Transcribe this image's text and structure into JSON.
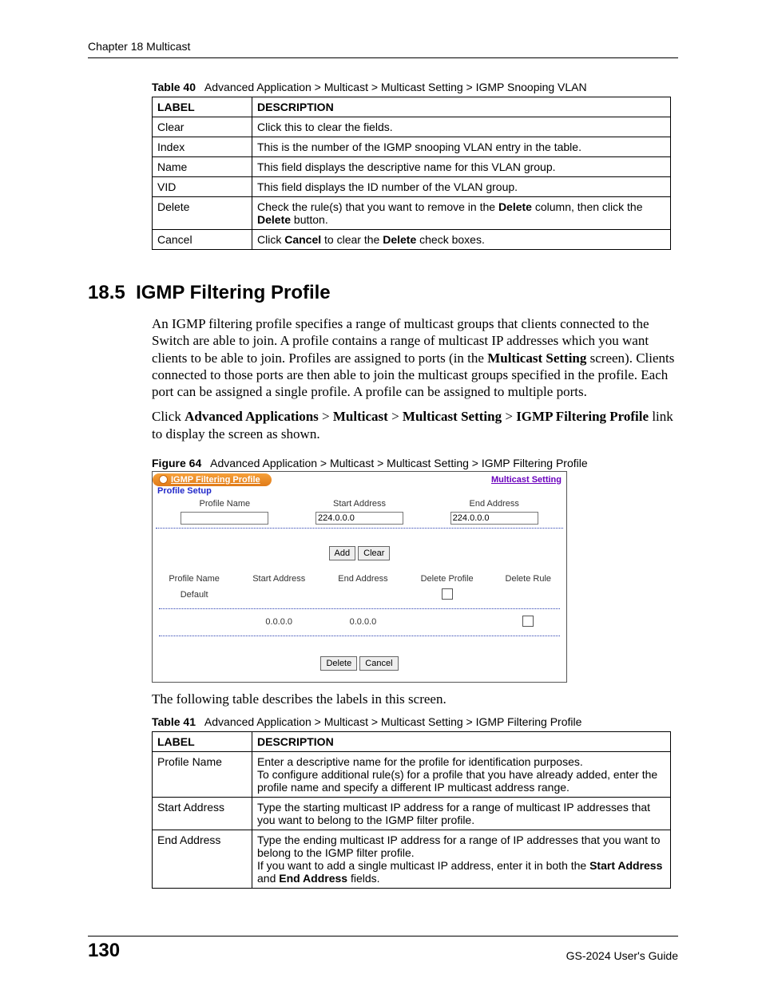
{
  "runningHead": "Chapter 18 Multicast",
  "table40": {
    "captionPrefix": "Table 40",
    "caption": "Advanced Application > Multicast > Multicast Setting > IGMP Snooping VLAN",
    "headerLabel": "LABEL",
    "headerDesc": "DESCRIPTION",
    "rows": [
      {
        "label": "Clear",
        "desc": "Click this to clear the fields."
      },
      {
        "label": "Index",
        "desc": "This is the number of the IGMP snooping VLAN entry in the table."
      },
      {
        "label": "Name",
        "desc": "This field displays the descriptive name for this VLAN group."
      },
      {
        "label": "VID",
        "desc": "This field displays the ID number of the VLAN group."
      },
      {
        "label": "Delete",
        "desc_html": "Check the rule(s) that you want to remove in the <b>Delete</b> column, then click the <b>Delete</b> button."
      },
      {
        "label": "Cancel",
        "desc_html": "Click <b>Cancel</b> to clear the <b>Delete</b> check boxes."
      }
    ]
  },
  "sectionNumber": "18.5",
  "sectionTitle": "IGMP Filtering Profile",
  "para1_html": "An IGMP filtering profile specifies a range of multicast groups that clients connected to the Switch are able to join. A profile contains a range of multicast IP addresses which you want clients to be able to join. Profiles are assigned to ports (in the <b>Multicast Setting</b> screen). Clients connected to those ports are then able to join the multicast groups specified in the profile. Each port can be assigned a single profile. A profile can be assigned to multiple ports.",
  "para2_html": "Click <b>Advanced Applications</b> > <b>Multicast</b> > <b>Multicast Setting</b> > <b>IGMP Filtering Profile</b> link to display the screen as shown.",
  "figure64": {
    "captionPrefix": "Figure 64",
    "caption": "Advanced Application > Multicast > Multicast Setting > IGMP Filtering Profile"
  },
  "screenshot": {
    "title": "IGMP Filtering Profile",
    "rightLink": "Multicast Setting",
    "subhead": "Profile Setup",
    "col1": "Profile Name",
    "col2": "Start Address",
    "col3": "End Address",
    "startDefault": "224.0.0.0",
    "endDefault": "224.0.0.0",
    "btnAdd": "Add",
    "btnClear": "Clear",
    "tbl": {
      "h1": "Profile Name",
      "h2": "Start Address",
      "h3": "End Address",
      "h4": "Delete Profile",
      "h5": "Delete Rule",
      "rowProfile": "Default",
      "rowStart": "0.0.0.0",
      "rowEnd": "0.0.0.0"
    },
    "btnDelete": "Delete",
    "btnCancel": "Cancel"
  },
  "para3": "The following table describes the labels in this screen.",
  "table41": {
    "captionPrefix": "Table 41",
    "caption": "Advanced Application > Multicast > Multicast Setting > IGMP Filtering Profile",
    "headerLabel": "LABEL",
    "headerDesc": "DESCRIPTION",
    "rows": [
      {
        "label": "Profile Name",
        "desc_html": "Enter a descriptive name for the profile for identification purposes.<br>To configure additional rule(s) for a profile that you have already added, enter the profile name and specify a different IP multicast address range."
      },
      {
        "label": "Start Address",
        "desc_html": "Type the starting multicast IP address for a range of multicast IP addresses that you want to belong to the IGMP filter profile."
      },
      {
        "label": "End Address",
        "desc_html": "Type the ending multicast IP address for a range of IP addresses that you want to belong to the IGMP filter profile.<br>If you want to add a single multicast IP address, enter it in both the <b>Start Address</b> and <b>End Address</b> fields."
      }
    ]
  },
  "pageNumber": "130",
  "guide": "GS-2024 User's Guide"
}
